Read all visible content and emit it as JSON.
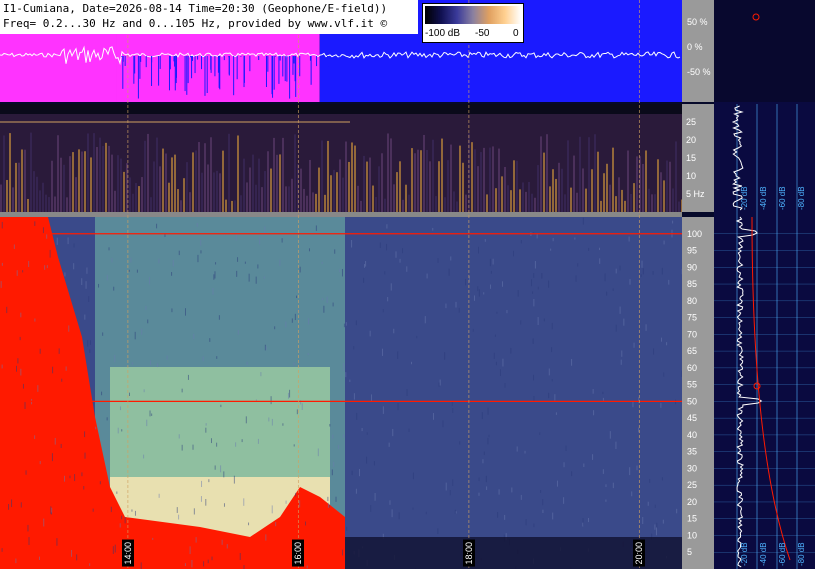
{
  "header": {
    "line1": "I1-Cumiana, Date=2026-08-14 Time=20:30 (Geophone/E-field))",
    "line2": "Freq= 0.2...30 Hz and 0...105 Hz, provided by www.vlf.it ©"
  },
  "colorbar": {
    "labels": [
      "-100 dB",
      "-50",
      "0"
    ],
    "stops": [
      "#000000",
      "#101050",
      "#3a3a9a",
      "#8a80a0",
      "#e0a060",
      "#ffd090",
      "#ffffff"
    ]
  },
  "colors": {
    "magenta": "#ff33ff",
    "blue": "#1a1aff",
    "red": "#ff1a00",
    "grid": "#4fb4ff",
    "background": "#06092a"
  },
  "chart_data": [
    {
      "type": "area",
      "panel": "amplitude",
      "yticks": [
        "50 %",
        "0 %",
        "-50 %"
      ],
      "ylim": [
        -100,
        100
      ],
      "segments": [
        {
          "color": "magenta",
          "from": "12:30",
          "to": "13:52"
        },
        {
          "color": "magenta",
          "from": "13:52",
          "to": "16:15"
        },
        {
          "color": "blue",
          "from": "16:15",
          "to": "20:30"
        }
      ]
    },
    {
      "type": "heatmap",
      "panel": "spectrogram-low",
      "ylabel": "Hz",
      "yticks": [
        "25",
        "20",
        "15",
        "10",
        "5 Hz"
      ],
      "ylim": [
        0,
        30
      ]
    },
    {
      "type": "heatmap",
      "panel": "spectrogram-high",
      "yticks": [
        "100",
        "95",
        "90",
        "85",
        "80",
        "75",
        "70",
        "65",
        "60",
        "55",
        "50",
        "45",
        "40",
        "35",
        "30",
        "25",
        "20",
        "15",
        "10",
        "5"
      ],
      "ylim": [
        0,
        105
      ],
      "xticks": [
        "14:00",
        "16:00",
        "18:00",
        "20:00"
      ],
      "lines_hz": [
        50,
        100
      ]
    },
    {
      "type": "line",
      "panel": "side-spectrum",
      "xticks": [
        "-20 dB",
        "-40 dB",
        "-60 dB",
        "-80 dB"
      ]
    }
  ]
}
